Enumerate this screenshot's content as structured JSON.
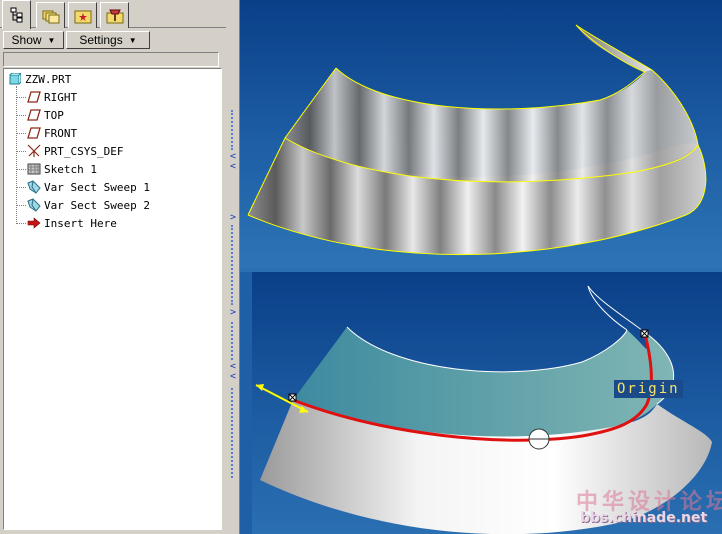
{
  "tabs": [
    {
      "icon": "model-tree-icon"
    },
    {
      "icon": "folder-browser-icon"
    },
    {
      "icon": "favorites-icon"
    },
    {
      "icon": "connections-icon"
    }
  ],
  "toolbar": {
    "show_label": "Show",
    "settings_label": "Settings"
  },
  "tree": {
    "root": {
      "label": "ZZW.PRT",
      "icon": "part-icon"
    },
    "items": [
      {
        "label": "RIGHT",
        "icon": "datum-plane-icon"
      },
      {
        "label": "TOP",
        "icon": "datum-plane-icon"
      },
      {
        "label": "FRONT",
        "icon": "datum-plane-icon"
      },
      {
        "label": "PRT_CSYS_DEF",
        "icon": "coordinate-system-icon"
      },
      {
        "label": "Sketch 1",
        "icon": "sketch-icon"
      },
      {
        "label": "Var Sect Sweep 1",
        "icon": "sweep-icon"
      },
      {
        "label": "Var Sect Sweep 2",
        "icon": "sweep-icon"
      },
      {
        "label": "Insert Here",
        "icon": "insert-here-arrow-icon"
      }
    ]
  },
  "viewport": {
    "origin_label": "Origin",
    "colors": {
      "background": "#0a3f88",
      "edge": "#ffff00",
      "trajectory": "#e01010",
      "label": "#f5e36a"
    }
  },
  "watermark": {
    "title": "中华设计论坛",
    "url": "bbs.chinade.net"
  }
}
